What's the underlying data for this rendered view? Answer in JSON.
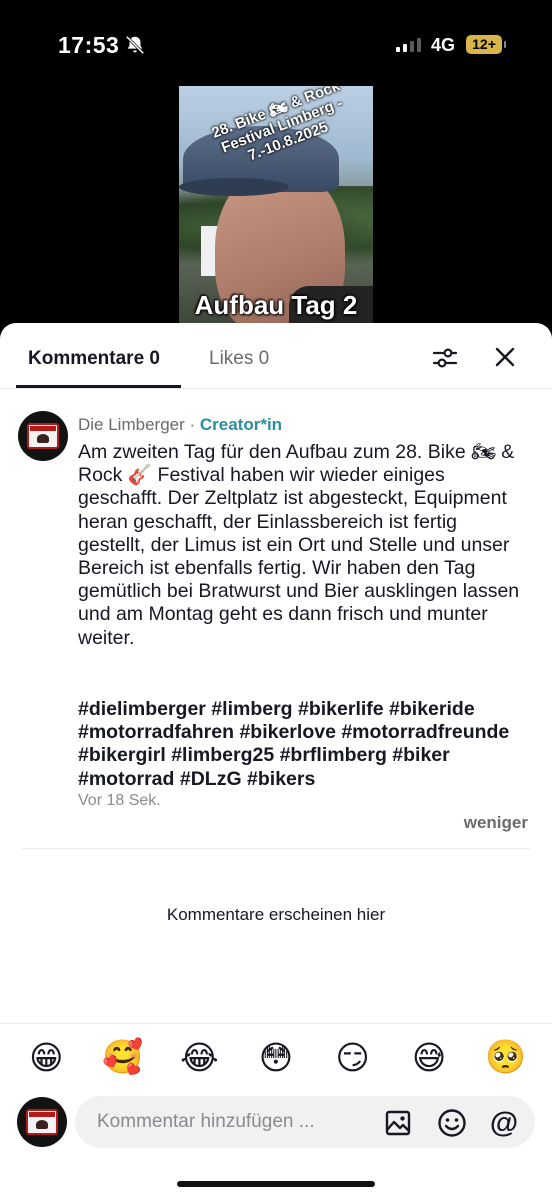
{
  "status_bar": {
    "time": "17:53",
    "network": "4G",
    "battery": "12+"
  },
  "video": {
    "overlay_top": "28. Bike 🏍 & Rock Festival Limberg - 7.-10.8.2025",
    "overlay_caption": "Aufbau Tag 2"
  },
  "tabs": {
    "comments_label": "Kommentare 0",
    "likes_label": "Likes 0"
  },
  "comment": {
    "author": "Die Limberger",
    "separator": " · ",
    "author_badge": "Creator*in",
    "text": "Am zweiten Tag für den Aufbau zum 28. Bike 🏍 & Rock 🎸 Festival haben wir wieder einiges geschafft. Der Zeltplatz ist abgesteckt, Equipment heran geschafft, der Einlassbereich ist fertig gestellt, der Limus ist ein Ort und Stelle und unser Bereich ist ebenfalls fertig. Wir haben den Tag gemütlich bei Bratwurst und Bier ausklingen lassen und am Montag geht es dann frisch und munter weiter.",
    "hashtags": "#dielimberger #limberg #bikerlife #bikeride #motorradfahren #bikerlove #motorradfreunde #bikergirl #limberg25 #brflimberg #biker #motorrad #DLzG #bikers",
    "timestamp": "Vor 18 Sek.",
    "collapse_label": "weniger"
  },
  "empty_state": "Kommentare erscheinen hier",
  "emojis": [
    "😁",
    "🥰",
    "😂",
    "😳",
    "😏",
    "😅",
    "🥺"
  ],
  "input": {
    "placeholder": "Kommentar hinzufügen ...",
    "at_symbol": "@"
  },
  "colors": {
    "creator_badge": "#2a8ea0",
    "text_primary": "#161823",
    "text_secondary": "#6b6b6f",
    "battery": "#d9b44a"
  }
}
